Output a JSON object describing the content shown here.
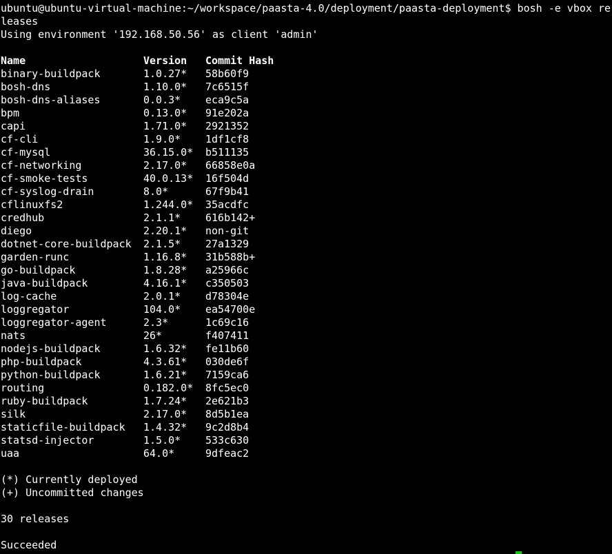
{
  "terminal": {
    "prompt_line": "ubuntu@ubuntu-virtual-machine:~/workspace/paasta-4.0/deployment/paasta-deployment$ bosh -e vbox re",
    "wrap_line": "leases",
    "env_line": "Using environment '192.168.50.56' as client 'admin'",
    "headers": {
      "name": "Name",
      "version": "Version",
      "hash": "Commit Hash"
    },
    "releases": [
      {
        "name": "binary-buildpack",
        "version": "1.0.27*",
        "hash": "58b60f9"
      },
      {
        "name": "bosh-dns",
        "version": "1.10.0*",
        "hash": "7c6515f"
      },
      {
        "name": "bosh-dns-aliases",
        "version": "0.0.3*",
        "hash": "eca9c5a"
      },
      {
        "name": "bpm",
        "version": "0.13.0*",
        "hash": "91e202a"
      },
      {
        "name": "capi",
        "version": "1.71.0*",
        "hash": "2921352"
      },
      {
        "name": "cf-cli",
        "version": "1.9.0*",
        "hash": "1df1cf8"
      },
      {
        "name": "cf-mysql",
        "version": "36.15.0*",
        "hash": "b511135"
      },
      {
        "name": "cf-networking",
        "version": "2.17.0*",
        "hash": "66858e0a"
      },
      {
        "name": "cf-smoke-tests",
        "version": "40.0.13*",
        "hash": "16f504d"
      },
      {
        "name": "cf-syslog-drain",
        "version": "8.0*",
        "hash": "67f9b41"
      },
      {
        "name": "cflinuxfs2",
        "version": "1.244.0*",
        "hash": "35acdfc"
      },
      {
        "name": "credhub",
        "version": "2.1.1*",
        "hash": "616b142+"
      },
      {
        "name": "diego",
        "version": "2.20.1*",
        "hash": "non-git"
      },
      {
        "name": "dotnet-core-buildpack",
        "version": "2.1.5*",
        "hash": "27a1329"
      },
      {
        "name": "garden-runc",
        "version": "1.16.8*",
        "hash": "31b588b+"
      },
      {
        "name": "go-buildpack",
        "version": "1.8.28*",
        "hash": "a25966c"
      },
      {
        "name": "java-buildpack",
        "version": "4.16.1*",
        "hash": "c350503"
      },
      {
        "name": "log-cache",
        "version": "2.0.1*",
        "hash": "d78304e"
      },
      {
        "name": "loggregator",
        "version": "104.0*",
        "hash": "ea54700e"
      },
      {
        "name": "loggregator-agent",
        "version": "2.3*",
        "hash": "1c69c16"
      },
      {
        "name": "nats",
        "version": "26*",
        "hash": "f407411"
      },
      {
        "name": "nodejs-buildpack",
        "version": "1.6.32*",
        "hash": "fe11b60"
      },
      {
        "name": "php-buildpack",
        "version": "4.3.61*",
        "hash": "030de6f"
      },
      {
        "name": "python-buildpack",
        "version": "1.6.21*",
        "hash": "7159ca6"
      },
      {
        "name": "routing",
        "version": "0.182.0*",
        "hash": "8fc5ec0"
      },
      {
        "name": "ruby-buildpack",
        "version": "1.7.24*",
        "hash": "2e621b3"
      },
      {
        "name": "silk",
        "version": "2.17.0*",
        "hash": "8d5b1ea"
      },
      {
        "name": "staticfile-buildpack",
        "version": "1.4.32*",
        "hash": "9c2d8b4"
      },
      {
        "name": "statsd-injector",
        "version": "1.5.0*",
        "hash": "533c630"
      },
      {
        "name": "uaa",
        "version": "64.0*",
        "hash": "9dfeac2"
      }
    ],
    "legend_deployed": "(*) Currently deployed",
    "legend_uncommitted": "(+) Uncommitted changes",
    "count_line": "30 releases",
    "status_line": "Succeeded",
    "cursor_color": "#19c119"
  }
}
